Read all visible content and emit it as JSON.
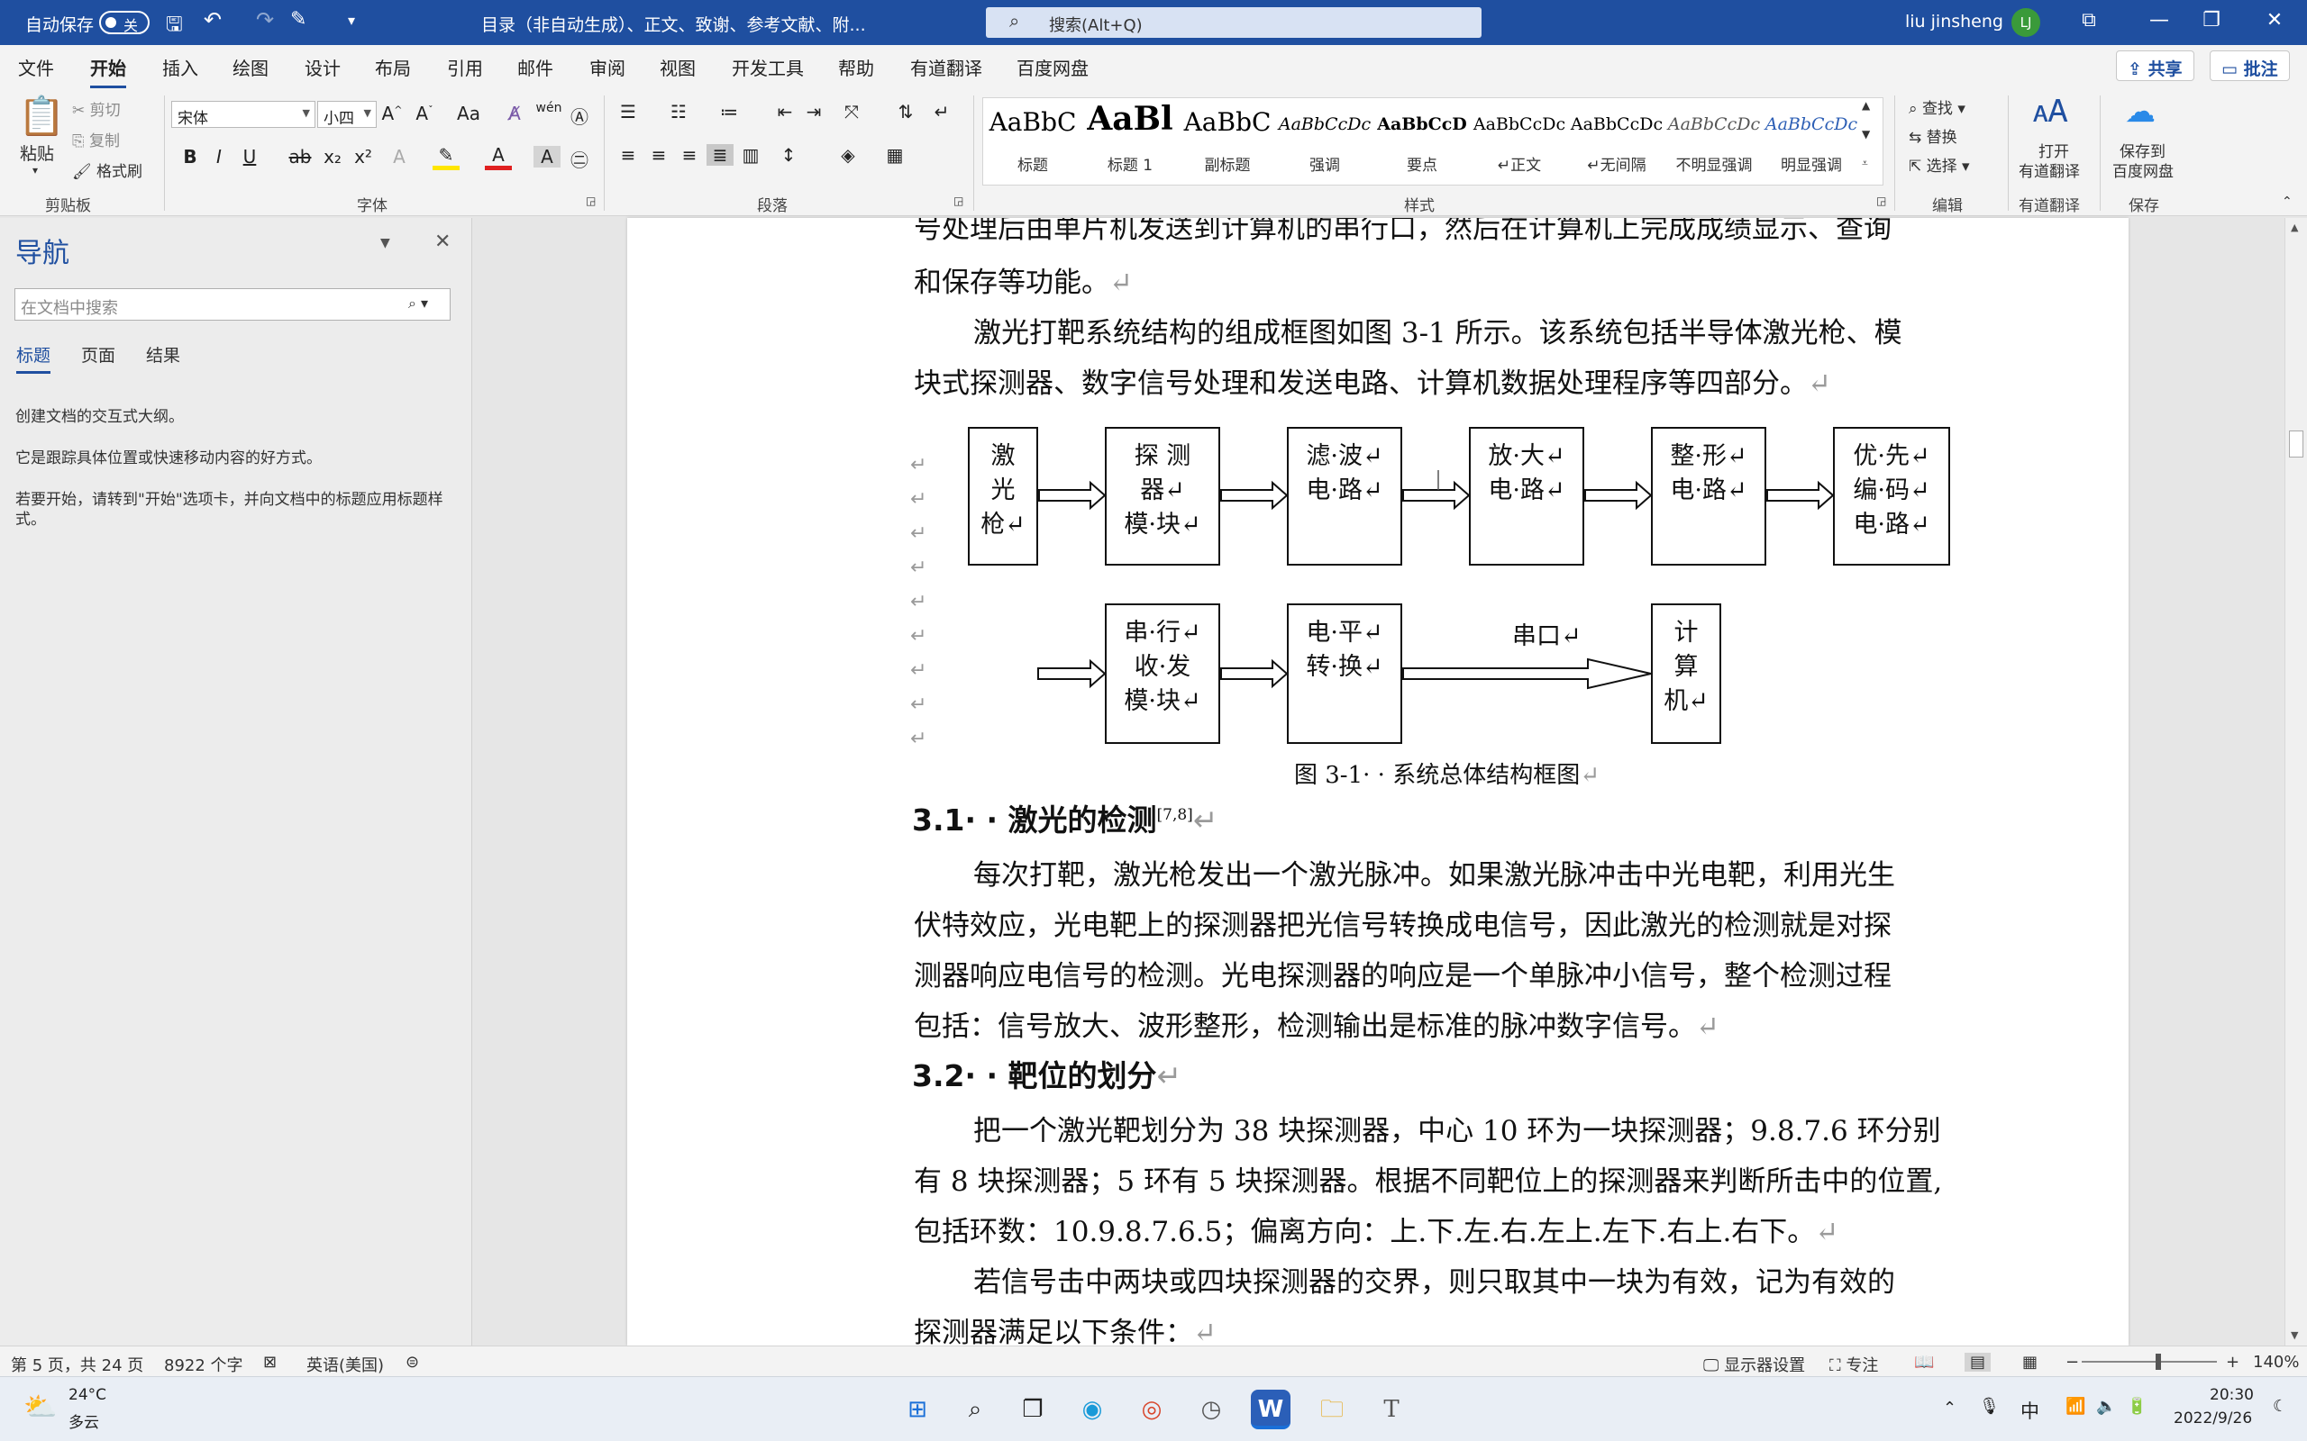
{
  "titlebar": {
    "autosave_label": "自动保存",
    "autosave_state": "关",
    "doc_title": "目录（非自动生成）、正文、致谢、参考文献、附...",
    "search_placeholder": "搜索(Alt+Q)",
    "user_name": "liu jinsheng",
    "user_initials": "LJ"
  },
  "tabs": [
    "文件",
    "开始",
    "插入",
    "绘图",
    "设计",
    "布局",
    "引用",
    "邮件",
    "审阅",
    "视图",
    "开发工具",
    "帮助",
    "有道翻译",
    "百度网盘"
  ],
  "tab_active": "开始",
  "share_label": "共享",
  "comments_label": "批注",
  "ribbon": {
    "clipboard": {
      "paste": "粘贴",
      "cut": "剪切",
      "copy": "复制",
      "format_painter": "格式刷",
      "label": "剪贴板"
    },
    "font": {
      "name": "宋体",
      "size": "小四",
      "label": "字体"
    },
    "paragraph": {
      "label": "段落"
    },
    "styles": {
      "label": "样式",
      "items": [
        {
          "sample": "AaBbC",
          "name": "标题"
        },
        {
          "sample": "AaBl",
          "name": "标题 1"
        },
        {
          "sample": "AaBbC",
          "name": "副标题"
        },
        {
          "sample": "AaBbCcDc",
          "name": "强调"
        },
        {
          "sample": "AaBbCcD",
          "name": "要点"
        },
        {
          "sample": "AaBbCcDc",
          "name": "↵正文"
        },
        {
          "sample": "AaBbCcDc",
          "name": "↵无间隔"
        },
        {
          "sample": "AaBbCcDc",
          "name": "不明显强调"
        },
        {
          "sample": "AaBbCcDc",
          "name": "明显强调"
        }
      ]
    },
    "editing": {
      "find": "查找",
      "replace": "替换",
      "select": "选择",
      "label": "编辑"
    },
    "youdao": {
      "open": "打开",
      "open2": "有道翻译",
      "label": "有道翻译"
    },
    "save": {
      "save": "保存到",
      "save2": "百度网盘",
      "label": "保存"
    }
  },
  "nav": {
    "title": "导航",
    "search_placeholder": "在文档中搜索",
    "tabs": [
      "标题",
      "页面",
      "结果"
    ],
    "text1": "创建文档的交互式大纲。",
    "text2": "它是跟踪具体位置或快速移动内容的好方式。",
    "text3": "若要开始，请转到\"开始\"选项卡，并向文档中的标题应用标题样式。"
  },
  "doc": {
    "line0": "号处理后由单片机发送到计算机的串行口，然后在计算机上完成成绩显示、查询",
    "line1": "和保存等功能。",
    "line2": "激光打靶系统结构的组成框图如图 3-1 所示。该系统包括半导体激光枪、模",
    "line3": "块式探测器、数字信号处理和发送电路、计算机数据处理程序等四部分。",
    "fig_caption": "图 3-1· · 系统总体结构框图",
    "h31": "3.1· · 激光的检测",
    "h31_sup": "[7,8]",
    "p31": [
      "每次打靶，激光枪发出一个激光脉冲。如果激光脉冲击中光电靶，利用光生",
      "伏特效应，光电靶上的探测器把光信号转换成电信号，因此激光的检测就是对探",
      "测器响应电信号的检测。光电探测器的响应是一个单脉冲小信号，整个检测过程",
      "包括：信号放大、波形整形，检测输出是标准的脉冲数字信号。"
    ],
    "h32": "3.2· · 靶位的划分",
    "p32": [
      "把一个激光靶划分为 38 块探测器，中心 10 环为一块探测器；9.8.7.6 环分别",
      "有 8 块探测器；5 环有 5 块探测器。根据不同靶位上的探测器来判断所击中的位置,",
      "包括环数：10.9.8.7.6.5；偏离方向：上.下.左.右.左上.左下.右上.右下。",
      "若信号击中两块或四块探测器的交界，则只取其中一块为有效，记为有效的",
      "探测器满足以下条件："
    ]
  },
  "diagram": {
    "boxes": [
      {
        "id": "laser-gun",
        "lines": [
          "激",
          "光",
          "枪↵"
        ]
      },
      {
        "id": "detector-module",
        "lines": [
          "探 测",
          "器↵",
          "模·块↵"
        ]
      },
      {
        "id": "filter-circuit",
        "lines": [
          "滤·波↵",
          "电·路↵"
        ]
      },
      {
        "id": "amplifier-circuit",
        "lines": [
          "放·大↵",
          "电·路↵"
        ]
      },
      {
        "id": "shaping-circuit",
        "lines": [
          "整·形↵",
          "电·路↵"
        ]
      },
      {
        "id": "priority-encoder",
        "lines": [
          "优·先↵",
          "编·码↵",
          "电·路↵"
        ]
      },
      {
        "id": "serial-transceiver",
        "lines": [
          "串·行↵",
          "收·发",
          "模·块↵"
        ]
      },
      {
        "id": "level-shifter",
        "lines": [
          "电·平↵",
          "转·换↵"
        ]
      },
      {
        "id": "computer",
        "lines": [
          "计",
          "算",
          "机↵"
        ]
      }
    ],
    "serial_label": "串口↵"
  },
  "status": {
    "page": "第 5 页，共 24 页",
    "words": "8922 个字",
    "language": "英语(美国)",
    "display_settings": "显示器设置",
    "focus": "专注",
    "zoom": "140%"
  },
  "taskbar": {
    "weather_temp": "24°C",
    "weather_desc": "多云",
    "ime": "中",
    "time": "20:30",
    "date": "2022/9/26"
  },
  "colors": {
    "accent": "#1f4fa0",
    "page": "#ffffff",
    "canvas": "#e6e6e6"
  }
}
